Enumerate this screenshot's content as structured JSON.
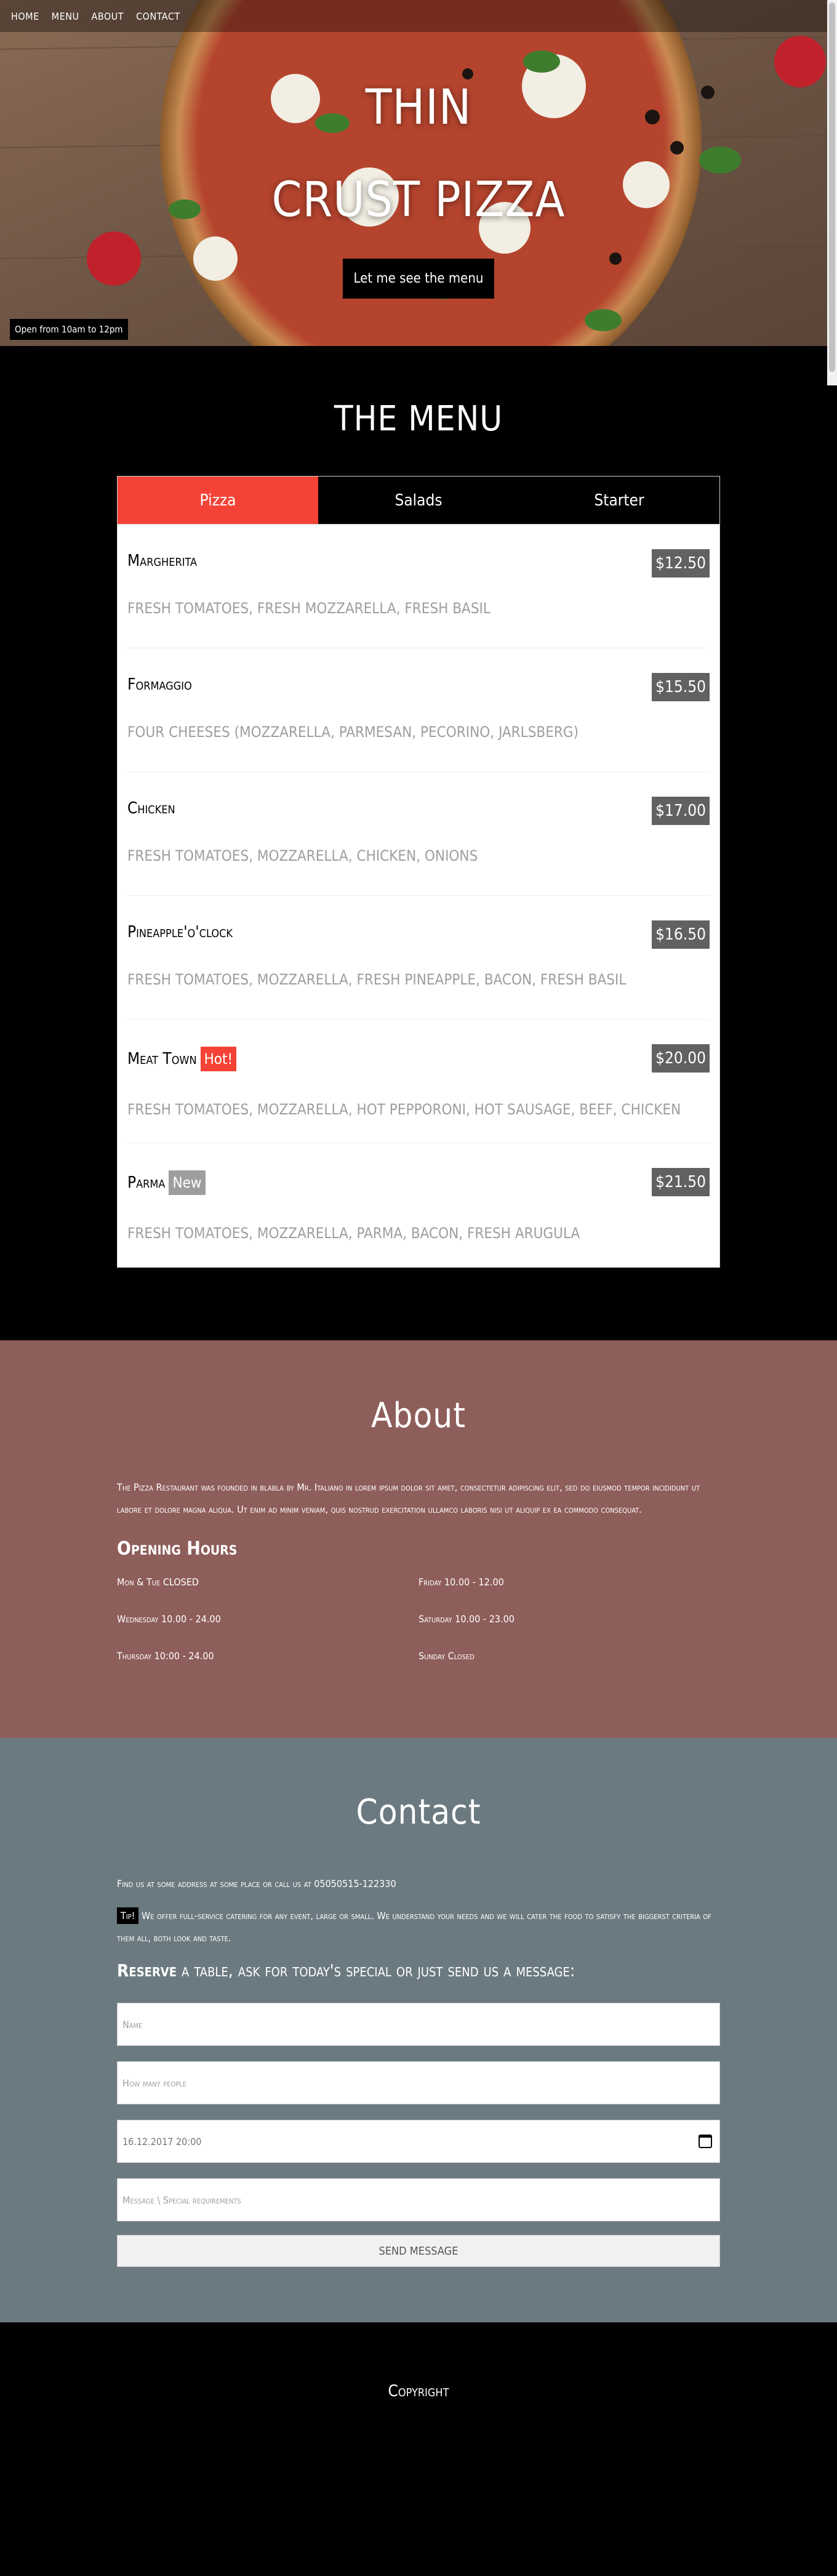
{
  "nav": {
    "items": [
      "HOME",
      "MENU",
      "ABOUT",
      "CONTACT"
    ]
  },
  "hero": {
    "title_line1": "Thin",
    "title_line2": "Crust Pizza",
    "cta": "Let me see the menu",
    "hours_badge": "Open from 10am to 12pm"
  },
  "menu": {
    "title": "THE MENU",
    "tabs": [
      "Pizza",
      "Salads",
      "Starter"
    ],
    "active_tab": "Pizza",
    "items": [
      {
        "name": "Margherita",
        "price": "$12.50",
        "desc": "Fresh tomatoes, fresh mozzarella, fresh basil",
        "tag": ""
      },
      {
        "name": "Formaggio",
        "price": "$15.50",
        "desc": "Four cheeses (mozzarella, parmesan, pecorino, jarlsberg)",
        "tag": ""
      },
      {
        "name": "Chicken",
        "price": "$17.00",
        "desc": "Fresh tomatoes, mozzarella, chicken, onions",
        "tag": ""
      },
      {
        "name": "Pineapple'o'clock",
        "price": "$16.50",
        "desc": "Fresh tomatoes, mozzarella, fresh pineapple, bacon, fresh basil",
        "tag": ""
      },
      {
        "name": "Meat Town",
        "price": "$20.00",
        "desc": "Fresh tomatoes, mozzarella, hot pepporoni, hot sausage, beef, chicken",
        "tag": "Hot!"
      },
      {
        "name": "Parma",
        "price": "$21.50",
        "desc": "Fresh tomatoes, mozzarella, parma, bacon, fresh arugula",
        "tag": "New"
      }
    ]
  },
  "about": {
    "title": "About",
    "text": "The Pizza Restaurant was founded in blabla by Mr. Italiano in lorem ipsum dolor sit amet, consectetur adipiscing elit, sed do eiusmod tempor incididunt ut labore et dolore magna aliqua. Ut enim ad minim veniam, quis nostrud exercitation ullamco laboris nisi ut aliquip ex ea commodo consequat.",
    "hours_title": "Opening Hours",
    "hours": [
      "Mon & Tue CLOSED",
      "Friday 10.00 - 12.00",
      "Wednesday 10.00 - 24.00",
      "Saturday 10.00 - 23.00",
      "Thursday 10:00 - 24.00",
      "Sunday Closed"
    ]
  },
  "contact": {
    "title": "Contact",
    "line1": "Find us at some address at some place or call us at 05050515-122330",
    "tip_label": "Tip!",
    "tip_text": "We offer full-service catering for any event, large or small. We understand your needs and we will cater the food to satisfy the biggerst criteria of them all, both look and taste.",
    "reserve_bold": "Reserve",
    "reserve_rest": "a table, ask for today's special or just send us a message:",
    "name_placeholder": "Name",
    "people_placeholder": "How many people",
    "date_value": "16.12.2017 20:00",
    "message_placeholder": "Message \\ Special requirements",
    "send_label": "SEND MESSAGE"
  },
  "footer": {
    "text": "Copyright"
  }
}
